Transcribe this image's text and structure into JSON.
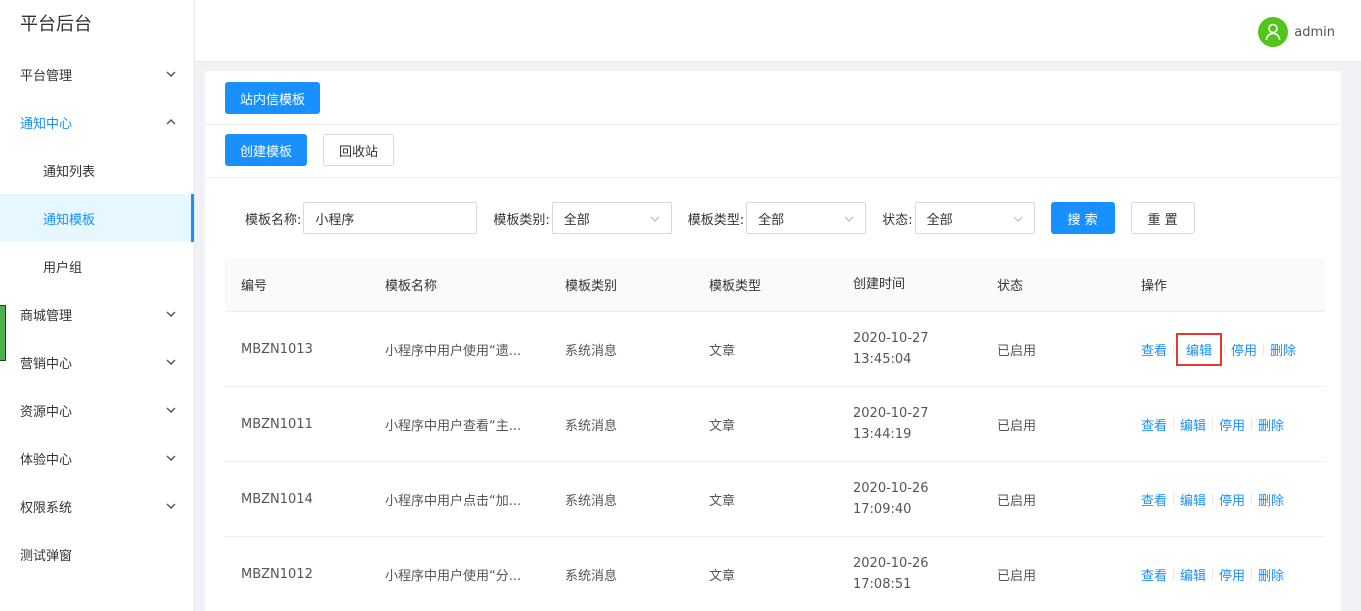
{
  "app": {
    "title": "平台后台"
  },
  "sidebar": {
    "items": [
      {
        "label": "平台管理"
      },
      {
        "label": "通知中心"
      },
      {
        "label": "通知列表"
      },
      {
        "label": "通知模板"
      },
      {
        "label": "用户组"
      },
      {
        "label": "商城管理"
      },
      {
        "label": "营销中心"
      },
      {
        "label": "资源中心"
      },
      {
        "label": "体验中心"
      },
      {
        "label": "权限系统"
      },
      {
        "label": "测试弹窗"
      }
    ]
  },
  "header": {
    "username": "admin"
  },
  "tabs": {
    "active": "站内信模板"
  },
  "actions": {
    "create": "创建模板",
    "recycle": "回收站"
  },
  "filters": {
    "name_label": "模板名称:",
    "name_value": "小程序",
    "category_label": "模板类别:",
    "category_value": "全部",
    "type_label": "模板类型:",
    "type_value": "全部",
    "status_label": "状态:",
    "status_value": "全部",
    "search": "搜 索",
    "reset": "重 置"
  },
  "table": {
    "headers": [
      "编号",
      "模板名称",
      "模板类别",
      "模板类型",
      "创建时间",
      "状态",
      "操作"
    ],
    "rows": [
      {
        "id": "MBZN1013",
        "name": "小程序中用户使用“遗...",
        "category": "系统消息",
        "type": "文章",
        "date": "2020-10-27",
        "time": "13:45:04",
        "status": "已启用"
      },
      {
        "id": "MBZN1011",
        "name": "小程序中用户查看“主...",
        "category": "系统消息",
        "type": "文章",
        "date": "2020-10-27",
        "time": "13:44:19",
        "status": "已启用"
      },
      {
        "id": "MBZN1014",
        "name": "小程序中用户点击“加...",
        "category": "系统消息",
        "type": "文章",
        "date": "2020-10-26",
        "time": "17:09:40",
        "status": "已启用"
      },
      {
        "id": "MBZN1012",
        "name": "小程序中用户使用“分...",
        "category": "系统消息",
        "type": "文章",
        "date": "2020-10-26",
        "time": "17:08:51",
        "status": "已启用"
      }
    ],
    "ops": {
      "view": "查看",
      "edit": "编辑",
      "disable": "停用",
      "delete": "删除"
    }
  },
  "colors": {
    "primary": "#1890ff",
    "highlight": "#e53935",
    "avatar": "#52c41a"
  },
  "icons": [
    "chevron-down-icon",
    "chevron-up-icon",
    "user-icon",
    "dropdown-arrow-icon"
  ]
}
